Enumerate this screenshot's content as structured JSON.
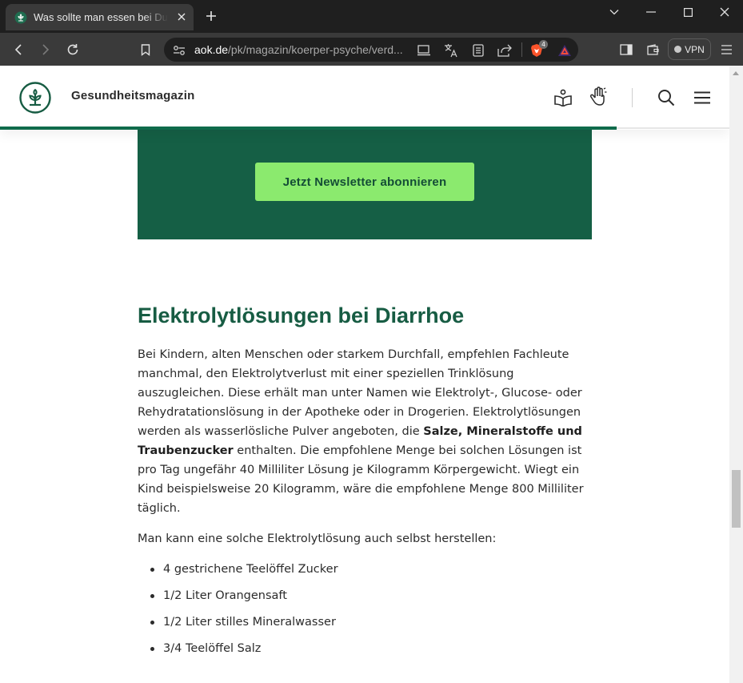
{
  "browser": {
    "tab_title": "Was sollte man essen bei Durchfall?",
    "url_host": "aok.de",
    "url_path": "/pk/magazin/koerper-psyche/verd...",
    "shields_count": "4",
    "vpn_label": "VPN"
  },
  "site": {
    "title": "Gesundheitsmagazin",
    "brand_color": "#155f45",
    "accent_color": "#8bea6e"
  },
  "promo": {
    "button_label": "Jetzt Newsletter abonnieren"
  },
  "article": {
    "heading": "Elektrolytlösungen bei Diarrhoe",
    "para1_part1": "Bei Kindern, alten Menschen oder starkem Durchfall, empfehlen Fachleute manchmal, den Elektrolytverlust mit einer speziellen Trinklösung auszugleichen. Diese erhält man unter Namen wie Elektrolyt-, Glucose- oder Rehydratationslösung in der Apotheke oder in Drogerien. Elektrolytlösungen werden als wasserlösliche Pulver angeboten, die ",
    "para1_bold": "Salze, Mineralstoffe und Traubenzucker",
    "para1_part2": " enthalten. Die empfohlene Menge bei solchen Lösungen ist pro Tag ungefähr 40 Milliliter Lösung je Kilogramm Körpergewicht. Wiegt ein Kind beispielsweise 20 Kilogramm, wäre die empfohlene Menge 800 Milliliter täglich.",
    "para2": "Man kann eine solche Elektrolytlösung auch selbst herstellen:",
    "ingredients": [
      "4 gestrichene Teelöffel Zucker",
      "1/2 Liter Orangensaft",
      "1/2 Liter stilles Mineralwasser",
      "3/4 Teelöffel Salz"
    ]
  }
}
